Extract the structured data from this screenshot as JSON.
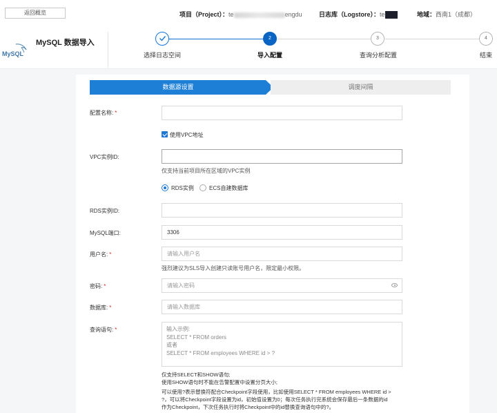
{
  "topbar": {
    "back_label": "返回概览",
    "project_label": "项目（Project）：",
    "project_prefix": "te",
    "project_suffix": "engdu",
    "logstore_label": "日志库（Logstore）：",
    "logstore_prefix": "te",
    "region_label": "地域：",
    "region_value": "西南1（成都）"
  },
  "header": {
    "logo_text": "MySQL",
    "app_title": "MySQL 数据导入",
    "steps": [
      {
        "label": "选择日志空间",
        "status": "done",
        "num": "1"
      },
      {
        "label": "导入配置",
        "status": "active",
        "num": "2"
      },
      {
        "label": "查询分析配置",
        "status": "todo",
        "num": "3"
      },
      {
        "label": "结束",
        "status": "todo",
        "num": "4"
      }
    ]
  },
  "tabs": {
    "active": "数据源设置",
    "inactive": "调度间隔"
  },
  "form": {
    "config_name": {
      "label": "配置名称:",
      "value": ""
    },
    "use_vpc": {
      "label": "使用VPC地址",
      "checked": true
    },
    "vpc_id": {
      "label": "VPC实例ID:",
      "value": "",
      "hint": "仅支持当前项目所在区域的VPC实例"
    },
    "instance_type": {
      "options": [
        "RDS实例",
        "ECS自建数据库"
      ],
      "selected": "RDS实例"
    },
    "rds_id": {
      "label": "RDS实例ID:",
      "value": ""
    },
    "port": {
      "label": "MySQL端口:",
      "value": "3306"
    },
    "username": {
      "label": "用户名:",
      "placeholder": "请输入用户名",
      "hint": "强烈建议为SLS导入创建只读账号用户名，限定最小权限。"
    },
    "password": {
      "label": "密码:",
      "placeholder": "请输入密码"
    },
    "database": {
      "label": "数据库:",
      "placeholder": "请输入数据库"
    },
    "query": {
      "label": "查询语句:",
      "placeholder_lines": [
        "输入示例:",
        "SELECT * FROM orders",
        "或者",
        "SELECT * FROM employees WHERE id > ?"
      ],
      "notes": [
        "仅支持SELECT和SHOW语句;",
        "使用SHOW语句时不能在告警配置中设置分页大小;",
        "可以使用?表示替换符配合Checkpoint字段使用，比如使用SELECT * FROM employees WHERE id >",
        "?，可以将Checkpoint字段设置为id，初始值设置为0；每次任务执行完系统会保存最后一条数据的id",
        "作为Checkpoint，下次任务执行时将Checkpoint中的id替换查询语句中的?。"
      ]
    }
  },
  "colors": {
    "accent": "#1e7fd6",
    "required": "#d9262c"
  }
}
